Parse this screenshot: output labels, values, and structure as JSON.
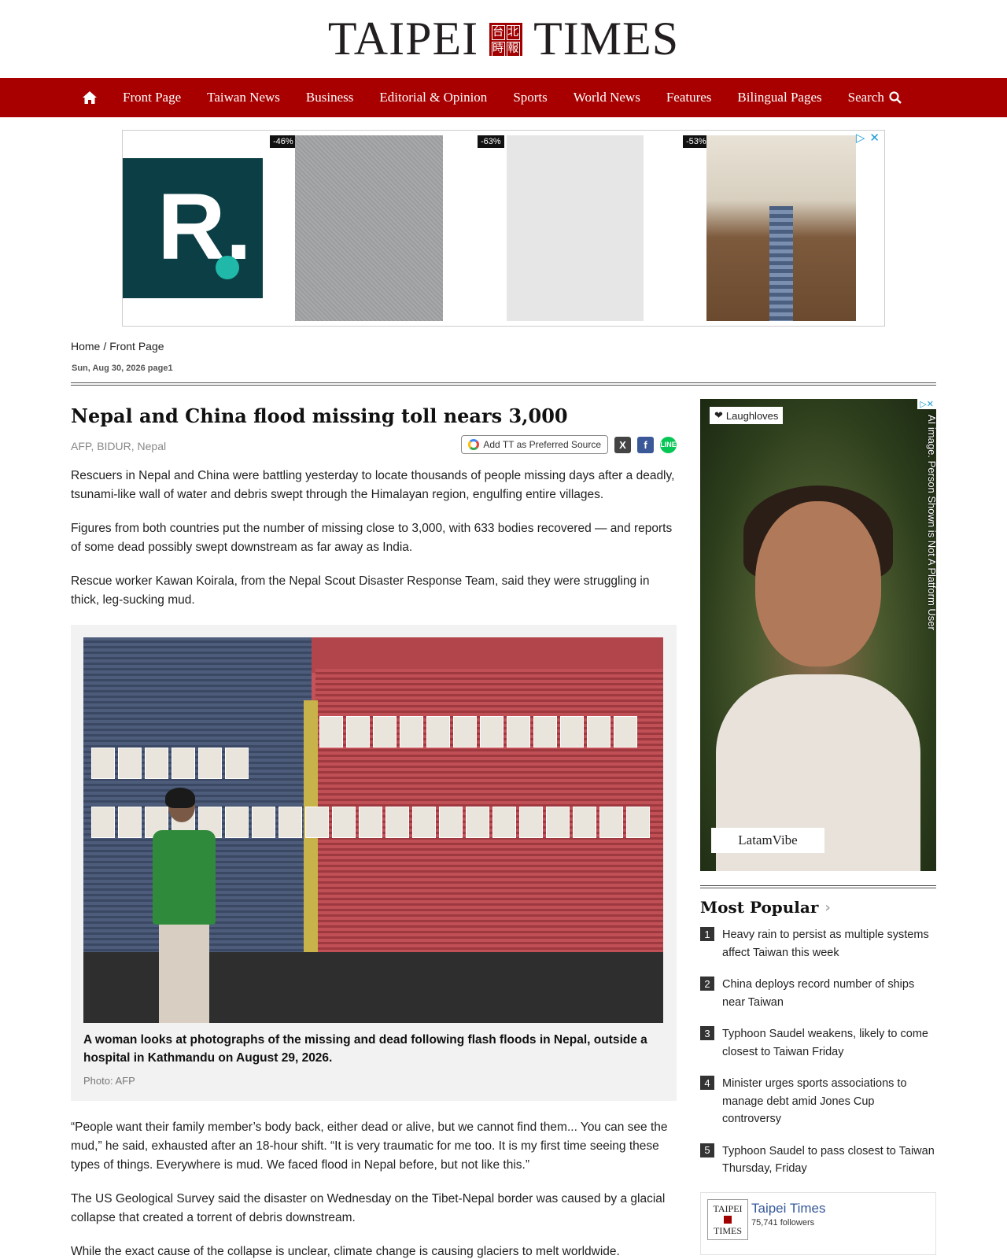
{
  "masthead": {
    "logo_left": "TAIPEI",
    "logo_right": "TIMES",
    "seal_chars": [
      "台",
      "北",
      "時",
      "報"
    ]
  },
  "nav": {
    "home_icon": "home-icon",
    "items": [
      "Front Page",
      "Taiwan News",
      "Business",
      "Editorial & Opinion",
      "Sports",
      "World News",
      "Features",
      "Bilingual Pages"
    ],
    "search_label": "Search",
    "color": "#a80000"
  },
  "top_ad": {
    "badges": [
      "-46%",
      "-63%",
      "-53%"
    ],
    "logo_letter": "R."
  },
  "breadcrumb": {
    "home": "Home",
    "separator": "/",
    "section": "Front Page"
  },
  "pubdate": "Sun, Aug 30, 2026 page1",
  "article": {
    "headline": "Nepal and China flood missing toll nears 3,000",
    "byline": "AFP, BIDUR, Nepal",
    "preferred_source_label": "Add TT as Preferred Source",
    "paragraphs_before": [
      "Rescuers in Nepal and China were battling yesterday to locate thousands of people missing days after a deadly, tsunami-like wall of water and debris swept through the Himalayan region, engulfing entire villages.",
      "Figures from both countries put the number of missing close to 3,000, with 633 bodies recovered — and reports of some dead possibly swept downstream as far away as India.",
      "Rescue worker Kawan Koirala, from the Nepal Scout Disaster Response Team, said they were struggling in thick, leg-sucking mud."
    ],
    "caption": "A woman looks at photographs of the missing and dead following flash floods in Nepal, outside a hospital in Kathmandu on August 29, 2026.",
    "photo_credit": "Photo: AFP",
    "paragraphs_after": [
      "“People want their family member’s body back, either dead or alive, but we cannot find them... You can see the mud,” he said, exhausted after an 18-hour shift. “It is very traumatic for me too. It is my first time seeing these types of things. Everywhere is mud. We faced flood in Nepal before, but not like this.”",
      "The US Geological Survey said the disaster on Wednesday on the Tibet-Nepal border was caused by a glacial collapse that created a torrent of debris downstream.",
      "While the exact cause of the collapse is unclear, climate change is causing glaciers to melt worldwide."
    ]
  },
  "side_ad": {
    "brand_top": "Laughloves",
    "brand_bottom": "LatamVibe",
    "vertical_text": "AI image. Person Shown is Not A Platform User"
  },
  "most_popular": {
    "title": "Most Popular",
    "items": [
      {
        "num": "1",
        "text": "Heavy rain to persist as multiple systems affect Taiwan this week"
      },
      {
        "num": "2",
        "text": "China deploys record number of ships near Taiwan"
      },
      {
        "num": "3",
        "text": "Typhoon Saudel weakens, likely to come closest to Taiwan Friday"
      },
      {
        "num": "4",
        "text": "Minister urges sports associations to manage debt amid Jones Cup controversy"
      },
      {
        "num": "5",
        "text": "Typhoon Saudel to pass closest to Taiwan Thursday, Friday"
      }
    ]
  },
  "facebook": {
    "name": "Taipei Times",
    "followers": "75,741 followers",
    "logo_top": "TAIPEI",
    "logo_bottom": "TIMES"
  }
}
